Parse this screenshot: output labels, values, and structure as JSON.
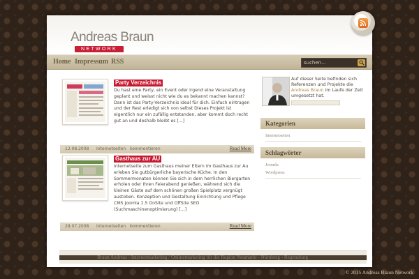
{
  "brand": {
    "name": "Andreas Braun",
    "subtitle": "NETWORK"
  },
  "nav": {
    "items": [
      "Home",
      "Impressum",
      "RSS"
    ]
  },
  "search": {
    "placeholder": "suchen..."
  },
  "posts": [
    {
      "title": "Party Verzeichnis",
      "excerpt": "Du hast eine Party, ein Event oder irgend eine Veranstaltung geplant und weisst nicht wie du es bekannt machen kannst? Dann ist das Party-Verzeichnis ideal für dich. Einfach eintragen und der Rest erledigt sich von selbst Dieses Projekt ist eigentlich nur ein zufällig entstanden, aber kommt doch recht gut an und deshalb bleibt es [...]",
      "date": "12.08.2008",
      "category": "Internetseiten",
      "comments": "kommentieren",
      "read_more": "Read More"
    },
    {
      "title": "Gasthaus zur AU",
      "excerpt": "Internetseite zum Gasthaus meiner Eltern im Gasthaus zur Au erleben Sie gutbürgerliche bayerische Küche. In den Sommermonaten können Sie sich in dem herrlichen Biergarten erholen oder Ihren Feierabend genießen, während sich die kleinen Gäste auf dem schönen großen Spielplatz vergnügt austoben. Konzeption und Gestaltung Einrichtung und Pflege CMS Joomla 1.5 OnSite und OffSite SEO (Suchmaschinenoptimierung) [...]",
      "date": "28.07.2008",
      "category": "Internetseiten",
      "comments": "kommentieren",
      "read_more": "Read More"
    }
  ],
  "sidebar": {
    "profile_text_before": "Auf dieser Seite befinden sich Referenzen und Projekte die ",
    "profile_text_highlight": "Andreas Braun",
    "profile_text_after": " im Laufe der Zeit umgesetzt hat.",
    "categories": {
      "title": "Kategorien",
      "items": [
        "Internetseiten"
      ]
    },
    "tags": {
      "title": "Schlagwörter",
      "items": [
        "Joomla",
        "Wordpress"
      ]
    }
  },
  "footer": {
    "text": "Braun Andreas - Internetmarketing / Onlinemarketing für die Region Neumarkt - Nürnberg - Regensburg",
    "copyright": "© 2015 Andreas Braun Network"
  },
  "colors": {
    "accent_red": "#c8182f",
    "nav_tan": "#c0b497",
    "background_brown": "#2f2219"
  }
}
